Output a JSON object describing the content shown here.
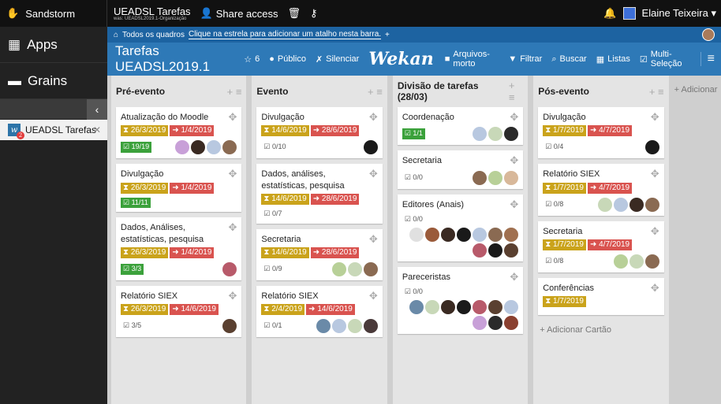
{
  "topbar": {
    "brand": "Sandstorm",
    "grain_title": "UEADSL Tarefas",
    "grain_subtitle": "was: UEADSL2019.1-Organização",
    "share_label": "Share access",
    "user_name": "Elaine Teixeira ▾"
  },
  "sidebar": {
    "apps_label": "Apps",
    "grains_label": "Grains",
    "collapse_glyph": "‹",
    "grain_tab_label": "UEADSL Tarefas",
    "grain_badge": "2",
    "grain_close": "✕"
  },
  "breadcrumb": {
    "all_boards": "Todos os quadros",
    "hint": "Clique na estrela para adicionar um atalho nesta barra.",
    "plus": "+"
  },
  "board_header": {
    "title": "Tarefas UEADSL2019.1",
    "stars": "6",
    "visibility": "Público",
    "mute": "Silenciar",
    "logo": "Wekan",
    "archive": "Arquivos-morto",
    "filter": "Filtrar",
    "search": "Buscar",
    "lists": "Listas",
    "multi": "Multi-Seleção",
    "menu_glyph": "≡"
  },
  "lists": [
    {
      "title": "Pré-evento",
      "cards": [
        {
          "title": "Atualização do Moodle",
          "received": "26/3/2019",
          "due": "1/4/2019",
          "checklist": "19/19",
          "done": true,
          "members": [
            "#c8a0d8",
            "#3a2a22",
            "#b8c8e0",
            "#8a6a52"
          ]
        },
        {
          "title": "Divulgação",
          "received": "26/3/2019",
          "due": "1/4/2019",
          "checklist": "11/11",
          "done": true,
          "members": []
        },
        {
          "title": "Dados, Análises, estatísticas, pesquisa",
          "received": "26/3/2019",
          "due": "1/4/2019",
          "checklist": "3/3",
          "done": true,
          "members": [
            "#b85a6a"
          ]
        },
        {
          "title": "Relatório SIEX",
          "received": "26/3/2019",
          "due": "14/6/2019",
          "checklist": "3/5",
          "done": false,
          "members": [
            "#5a4030"
          ]
        }
      ]
    },
    {
      "title": "Evento",
      "cards": [
        {
          "title": "Divulgação",
          "received": "14/6/2019",
          "due": "28/6/2019",
          "checklist": "0/10",
          "done": false,
          "members": [
            "#1a1a1a"
          ]
        },
        {
          "title": "Dados, análises, estatísticas, pesquisa",
          "received": "14/6/2019",
          "due": "28/6/2019",
          "checklist": "0/7",
          "done": false,
          "members": []
        },
        {
          "title": "Secretaria",
          "received": "14/6/2019",
          "due": "28/6/2019",
          "checklist": "0/9",
          "done": false,
          "members": [
            "#b8d098",
            "#c8d8b8",
            "#8a6a52"
          ]
        },
        {
          "title": "Relatório SIEX",
          "received": "2/4/2019",
          "due": "14/6/2019",
          "checklist": "0/1",
          "done": false,
          "members": [
            "#6a8aa8",
            "#b8c8e0",
            "#c8d8b8",
            "#4a3a3a"
          ]
        }
      ]
    },
    {
      "title": "Divisão de tarefas (28/03)",
      "cards": [
        {
          "title": "Coordenação",
          "received": "",
          "due": "",
          "checklist": "1/1",
          "done": true,
          "members": [
            "#b8c8e0",
            "#c8d8b8",
            "#2a2a2a"
          ]
        },
        {
          "title": "Secretaria",
          "received": "",
          "due": "",
          "checklist": "0/0",
          "done": false,
          "members": [
            "#8a6a52",
            "#b8d098",
            "#d8b89a"
          ]
        },
        {
          "title": "Editores (Anais)",
          "received": "",
          "due": "",
          "checklist": "0/0",
          "done": false,
          "members": [
            "#e0e0e0",
            "#9a5a3a",
            "#3a2a22",
            "#1a1a1a",
            "#b8c8e0",
            "#8a6a52",
            "#a07050",
            "#b85a6a",
            "#1a1a1a",
            "#5a4030"
          ]
        },
        {
          "title": "Pareceristas",
          "received": "",
          "due": "",
          "checklist": "0/0",
          "done": false,
          "members": [
            "#6a8aa8",
            "#c8d8b8",
            "#3a2a22",
            "#1a1a1a",
            "#b85a6a",
            "#5a4030",
            "#b8c8e0",
            "#c8a0d8",
            "#2a2a2a",
            "#8a4030"
          ]
        }
      ]
    },
    {
      "title": "Pós-evento",
      "cards": [
        {
          "title": "Divulgação",
          "received": "1/7/2019",
          "due": "4/7/2019",
          "checklist": "0/4",
          "done": false,
          "members": [
            "#1a1a1a"
          ]
        },
        {
          "title": "Relatório SIEX",
          "received": "1/7/2019",
          "due": "4/7/2019",
          "checklist": "0/8",
          "done": false,
          "members": [
            "#c8d8b8",
            "#b8c8e0",
            "#3a2a22",
            "#8a6a52"
          ]
        },
        {
          "title": "Secretaria",
          "received": "1/7/2019",
          "due": "4/7/2019",
          "checklist": "0/8",
          "done": false,
          "members": [
            "#b8d098",
            "#c8d8b8",
            "#8a6a52"
          ]
        },
        {
          "title": "Conferências",
          "received": "1/7/2019",
          "due": "",
          "checklist": "",
          "done": false,
          "members": []
        }
      ],
      "add_card": "Adicionar Cartão"
    }
  ],
  "add_list": "+ Adicionar"
}
